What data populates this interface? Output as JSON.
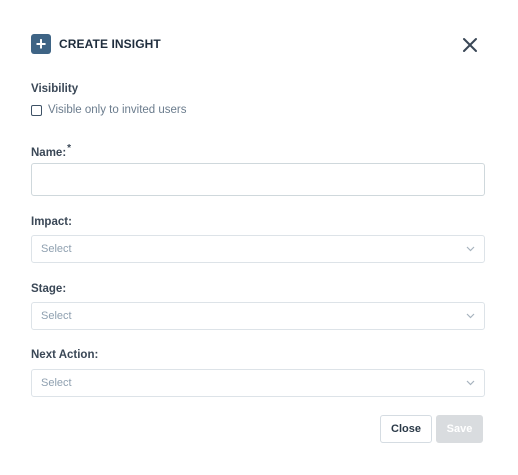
{
  "header": {
    "title": "CREATE INSIGHT",
    "plus_glyph": "+",
    "icon": "plus-icon",
    "close_icon": "close-icon"
  },
  "visibility": {
    "label": "Visibility",
    "checkbox_label": "Visible only to invited users",
    "checked": false
  },
  "name_field": {
    "label": "Name:",
    "required_mark": "*",
    "value": "",
    "placeholder": ""
  },
  "impact": {
    "label": "Impact:",
    "selected": "Select"
  },
  "stage": {
    "label": "Stage:",
    "selected": "Select"
  },
  "next_action": {
    "label": "Next Action:",
    "selected": "Select"
  },
  "footer": {
    "close_label": "Close",
    "save_label": "Save"
  },
  "colors": {
    "accent": "#3e6485",
    "save_disabled": "#d9dcdf"
  }
}
